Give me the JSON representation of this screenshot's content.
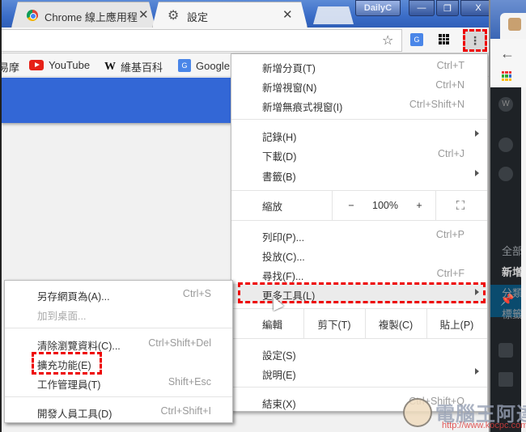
{
  "browser": {
    "tabs": [
      {
        "title": "Chrome 線上應用程",
        "icon": "chrome-webstore-icon",
        "closable": true
      },
      {
        "title": "設定",
        "icon": "gear-icon",
        "closable": true
      }
    ],
    "tab_close_glyph": "✕",
    "window_label": "DailyC",
    "window_controls": {
      "minimize": "—",
      "maximize": "❐",
      "close": "X"
    },
    "toolbar": {
      "star_glyph": "☆",
      "menu_glyph": "⋮",
      "translate_glyph": "G"
    },
    "bookmarks": [
      {
        "label": "易摩",
        "icon": ""
      },
      {
        "label": "YouTube",
        "icon": "youtube-icon"
      },
      {
        "label": "維基百科",
        "icon": "wikipedia-icon",
        "glyph": "W"
      },
      {
        "label": "Google",
        "icon": "google-translate-icon",
        "glyph": "G"
      }
    ],
    "accent_color": "#3367d6"
  },
  "main_menu": {
    "items": [
      {
        "label": "新增分頁(T)",
        "shortcut": "Ctrl+T"
      },
      {
        "label": "新增視窗(N)",
        "shortcut": "Ctrl+N"
      },
      {
        "label": "新增無痕式視窗(I)",
        "shortcut": "Ctrl+Shift+N"
      },
      {
        "label": "記錄(H)",
        "submenu": true
      },
      {
        "label": "下載(D)",
        "shortcut": "Ctrl+J"
      },
      {
        "label": "書籤(B)",
        "submenu": true
      }
    ],
    "zoom": {
      "label": "縮放",
      "minus": "−",
      "value": "100%",
      "plus": "+",
      "fullscreen_glyph": "⛶"
    },
    "items2": [
      {
        "label": "列印(P)...",
        "shortcut": "Ctrl+P"
      },
      {
        "label": "投放(C)..."
      },
      {
        "label": "尋找(F)...",
        "shortcut": "Ctrl+F"
      },
      {
        "label": "更多工具(L)",
        "submenu": true,
        "highlighted": true
      }
    ],
    "edit": {
      "label": "編輯",
      "cut": "剪下(T)",
      "copy": "複製(C)",
      "paste": "貼上(P)"
    },
    "items3": [
      {
        "label": "設定(S)"
      },
      {
        "label": "說明(E)",
        "submenu": true
      }
    ],
    "exit": {
      "label": "結束(X)",
      "shortcut": "Ctrl+Shift+Q"
    }
  },
  "more_tools_submenu": {
    "items": [
      {
        "label": "另存網頁為(A)...",
        "shortcut": "Ctrl+S"
      },
      {
        "label": "加到桌面...",
        "disabled": true
      },
      {
        "label": "清除瀏覽資料(C)...",
        "shortcut": "Ctrl+Shift+Del"
      },
      {
        "label": "擴充功能(E)",
        "highlighted": true
      },
      {
        "label": "工作管理員(T)",
        "shortcut": "Shift+Esc"
      },
      {
        "label": "開發人員工具(D)",
        "shortcut": "Ctrl+Shift+I"
      }
    ]
  },
  "second_window": {
    "back_glyph": "←",
    "sidebar_items": [
      "全部",
      "新增",
      "分類",
      "標籤"
    ]
  },
  "watermark": {
    "title": "電腦王阿達",
    "url": "http://www.kocpc.com.tw"
  },
  "highlight_color": "#ee0000"
}
